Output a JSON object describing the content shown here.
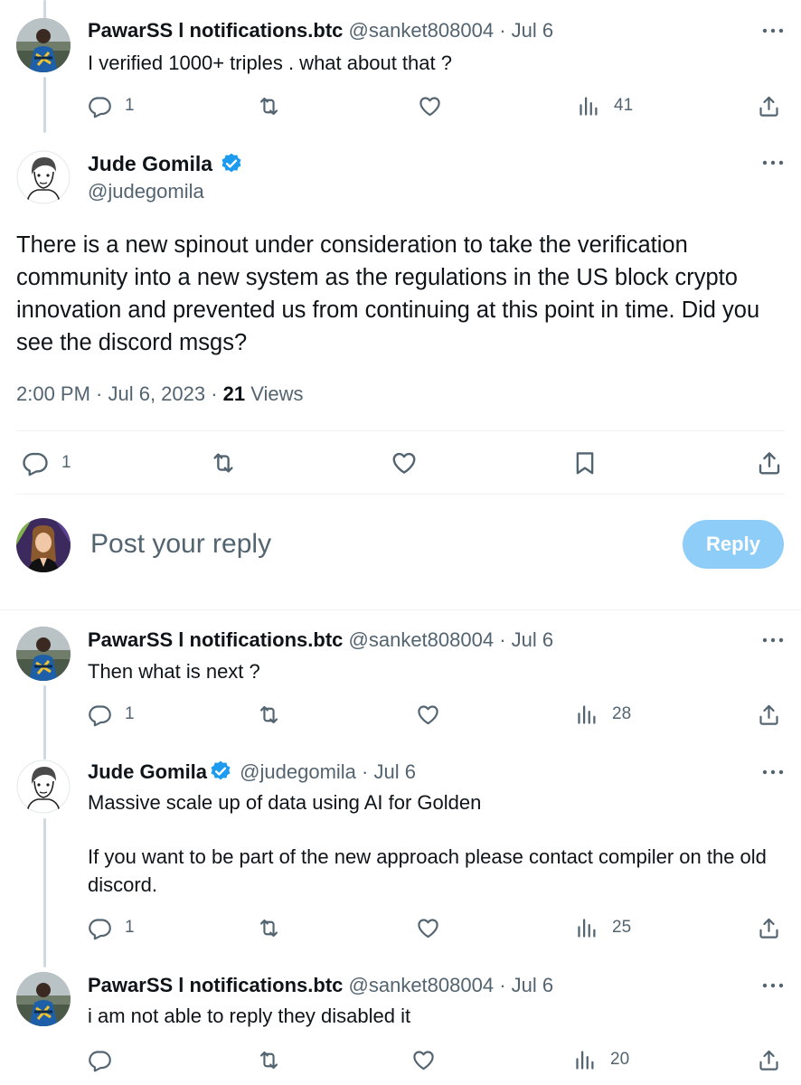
{
  "colors": {
    "accent": "#1d9bf0",
    "reply_button_bg": "#8ecdf8",
    "muted": "#536471",
    "thread_line": "#cfd9de"
  },
  "top_reply": {
    "name": "PawarSS l notifications.btc",
    "handle": "@sanket808004",
    "date": "Jul 6",
    "text": "I verified 1000+ triples . what about that ?",
    "replies": "1",
    "views": "41"
  },
  "main_tweet": {
    "name": "Jude Gomila",
    "handle": "@judegomila",
    "text": "There is a new spinout under consideration to take the verification community into a new system as the regulations in the US block crypto innovation and prevented us from continuing at this point in time. Did you see the discord msgs?",
    "time": "2:00 PM · Jul 6, 2023 · ",
    "views_count": "21",
    "views_label": " Views",
    "replies": "1"
  },
  "reply_composer": {
    "placeholder": "Post your reply",
    "button_label": "Reply"
  },
  "replies": [
    {
      "name": "PawarSS l notifications.btc",
      "handle": "@sanket808004",
      "date": "Jul 6",
      "text": "Then what is next ?",
      "replies": "1",
      "views": "28"
    },
    {
      "name": "Jude Gomila",
      "handle": "@judegomila",
      "date": "Jul 6",
      "text_line1": "Massive scale up of data using AI for Golden",
      "text_line2": "If you want to be part of the new approach please contact compiler on the old discord.",
      "replies": "1",
      "views": "25"
    },
    {
      "name": "PawarSS l notifications.btc",
      "handle": "@sanket808004",
      "date": "Jul 6",
      "text": "i am not able to reply they disabled it",
      "replies": "",
      "views": "20"
    }
  ],
  "icons": [
    "reply-icon",
    "retweet-icon",
    "like-icon",
    "views-icon",
    "share-icon",
    "bookmark-icon",
    "more-icon",
    "verified-badge-icon"
  ]
}
